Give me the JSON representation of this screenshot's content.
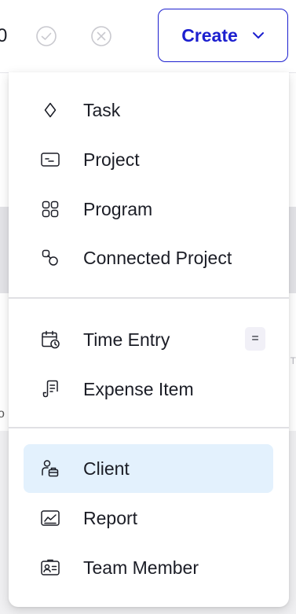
{
  "topbar": {
    "digit": "0",
    "create_label": "Create"
  },
  "menu": {
    "items": [
      {
        "label": "Task",
        "icon": "diamond-icon"
      },
      {
        "label": "Project",
        "icon": "project-icon"
      },
      {
        "label": "Program",
        "icon": "grid-icon"
      },
      {
        "label": "Connected Project",
        "icon": "connected-icon"
      },
      {
        "label": "Time Entry",
        "icon": "calendar-clock-icon",
        "shortcut": "="
      },
      {
        "label": "Expense Item",
        "icon": "receipt-icon"
      },
      {
        "label": "Client",
        "icon": "client-icon",
        "active": true
      },
      {
        "label": "Report",
        "icon": "chart-icon"
      },
      {
        "label": "Team Member",
        "icon": "id-card-icon"
      }
    ]
  },
  "colors": {
    "accent": "#1c1fcf",
    "active_bg": "#e3f1fd",
    "text": "#1b1d26"
  }
}
